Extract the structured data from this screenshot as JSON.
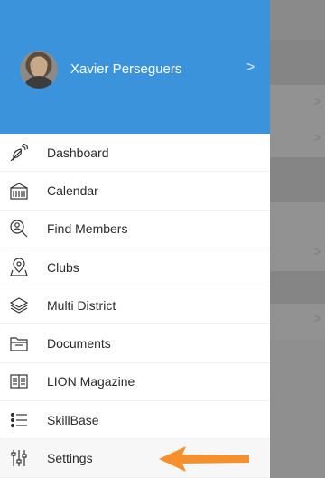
{
  "profile": {
    "name": "Xavier Perseguers",
    "chevron": ">"
  },
  "menu": {
    "items": [
      {
        "label": "Dashboard",
        "icon": "satellite-dish-icon"
      },
      {
        "label": "Calendar",
        "icon": "calendar-icon"
      },
      {
        "label": "Find Members",
        "icon": "find-members-icon"
      },
      {
        "label": "Clubs",
        "icon": "map-pin-icon"
      },
      {
        "label": "Multi District",
        "icon": "layers-icon"
      },
      {
        "label": "Documents",
        "icon": "folder-icon"
      },
      {
        "label": "LION Magazine",
        "icon": "open-book-icon"
      },
      {
        "label": "SkillBase",
        "icon": "bullet-list-icon"
      },
      {
        "label": "Settings",
        "icon": "sliders-icon"
      }
    ]
  },
  "background": {
    "chevrons": [
      ">",
      ">",
      ">",
      ">"
    ]
  },
  "colors": {
    "header": "#3b93db",
    "arrow": "#f5902c",
    "overlay": "#8f8f8f"
  }
}
